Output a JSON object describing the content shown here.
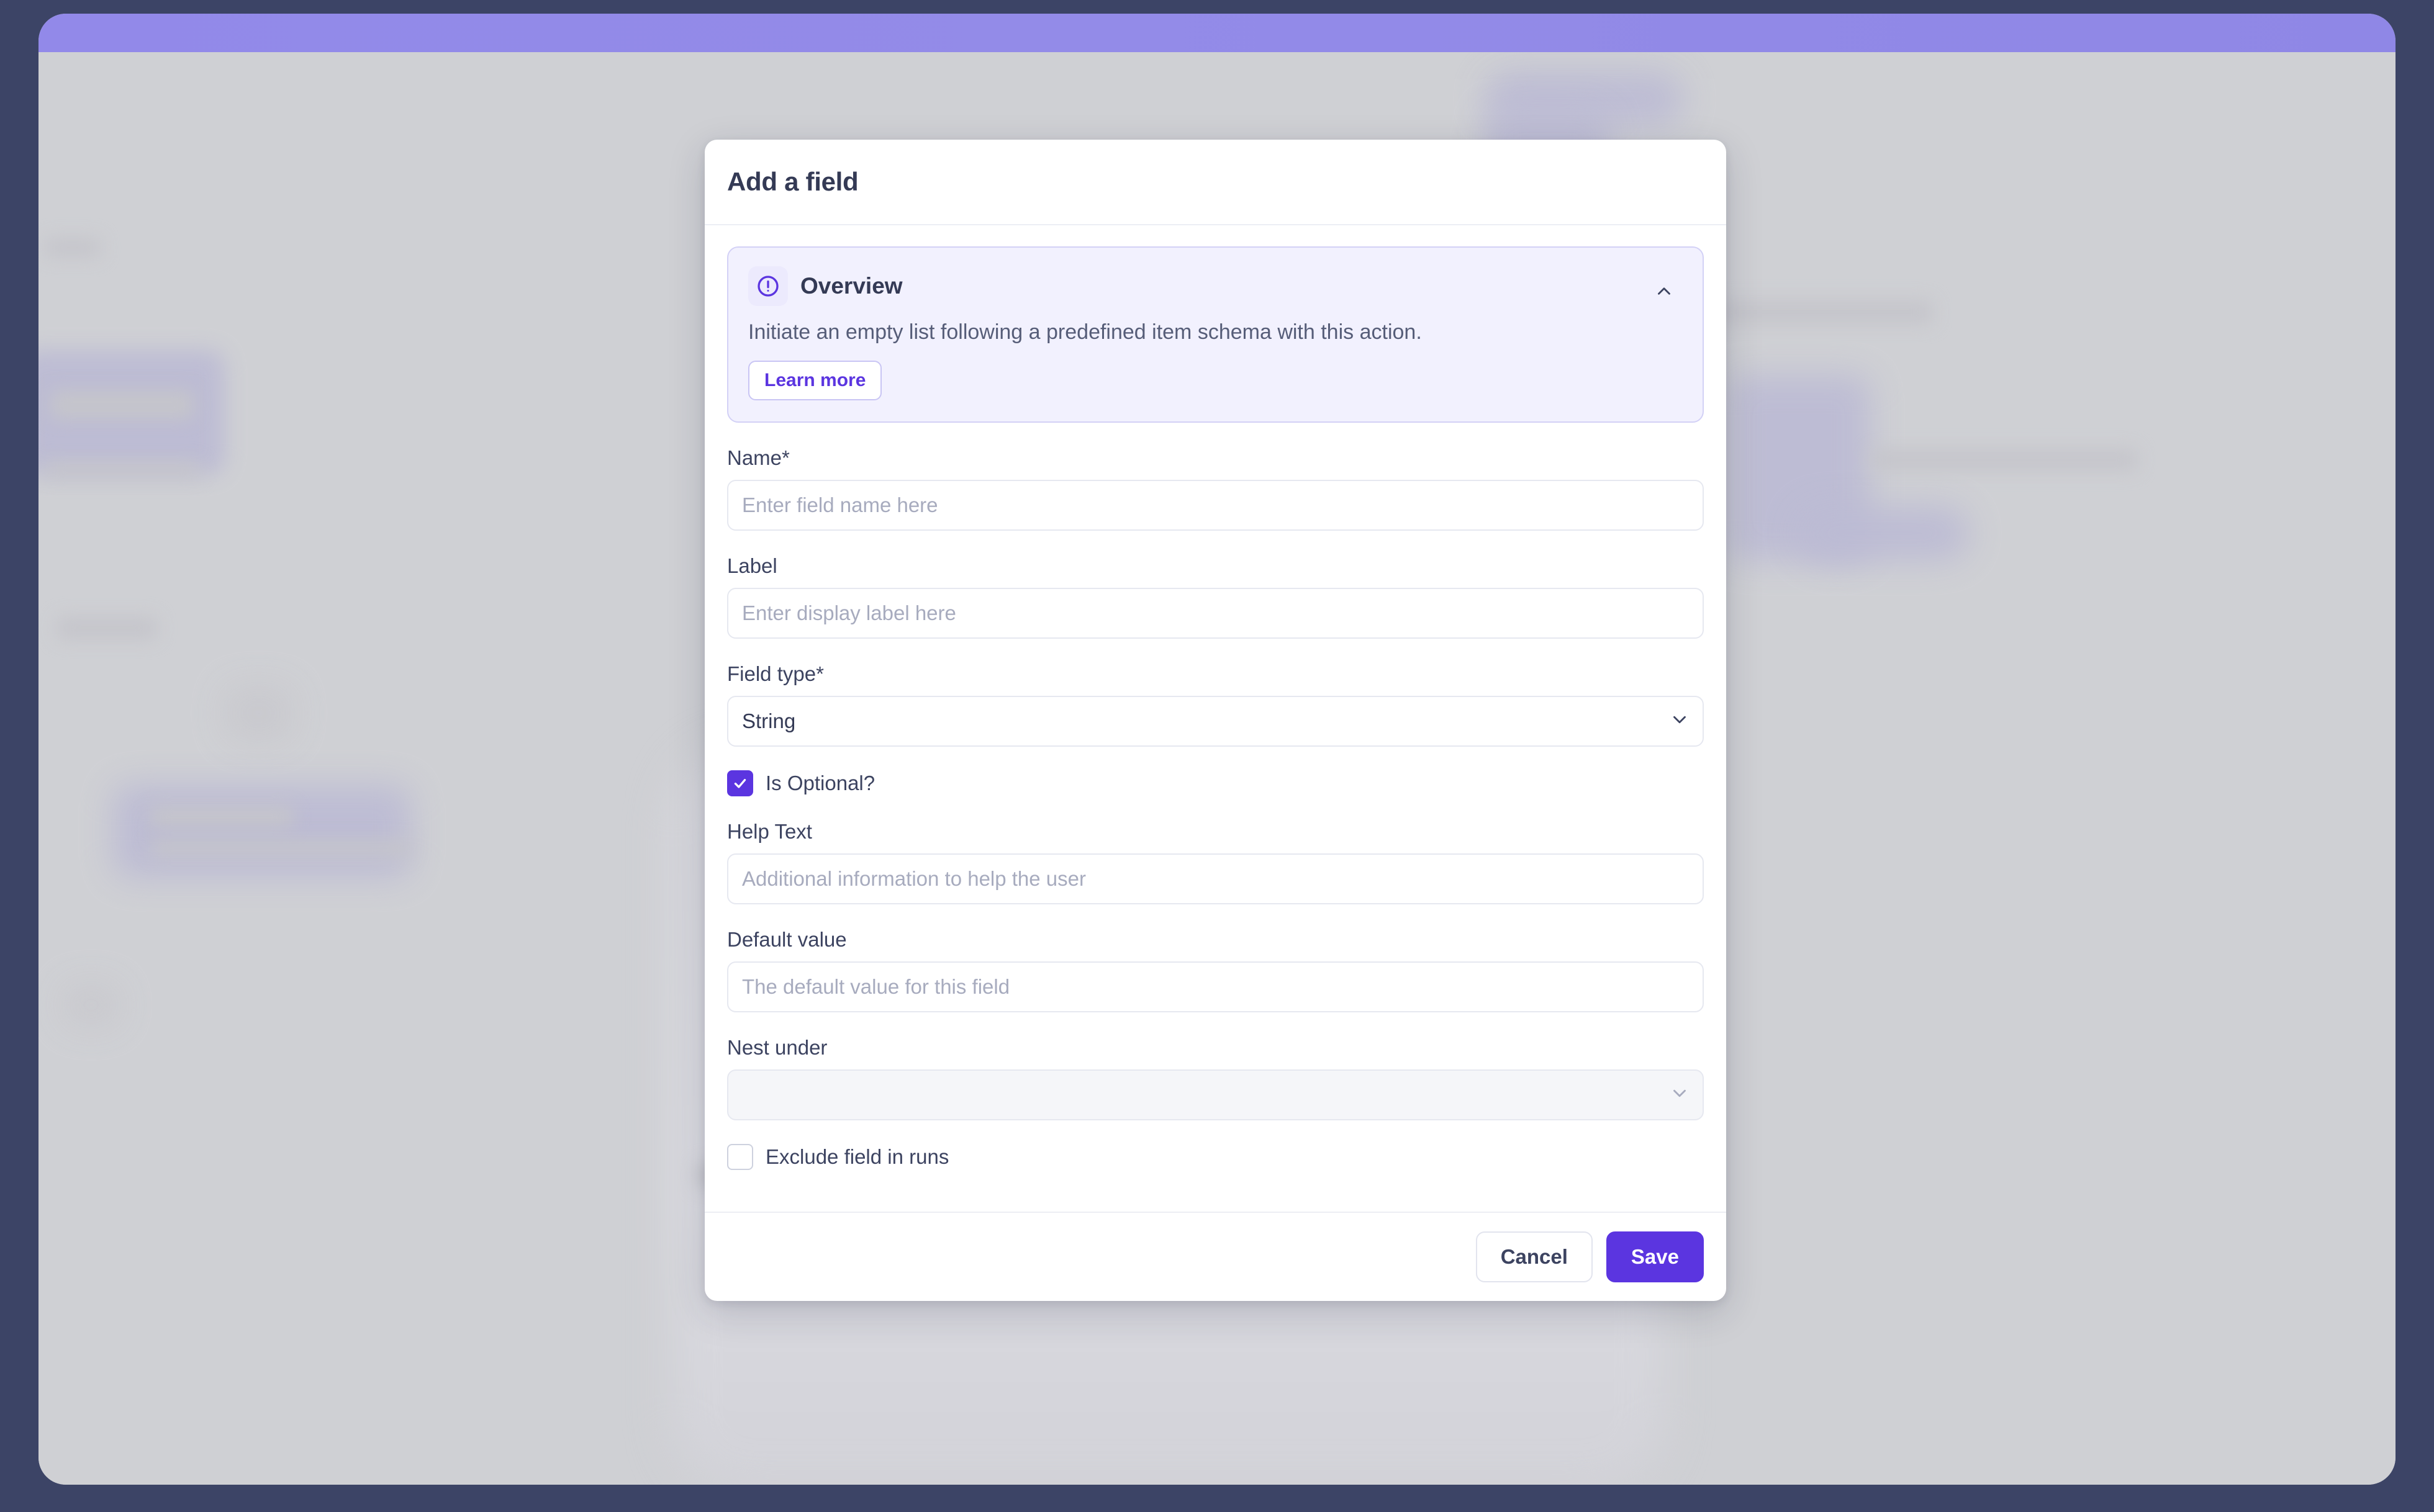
{
  "window": {
    "frame_color": "#3c4466",
    "top_band_color": "#938be8",
    "canvas_color": "#cfd0d4"
  },
  "theme": {
    "accent": "#5b35e0",
    "text_dark": "#343a55",
    "text_muted": "#565d78",
    "placeholder": "#a7abbe",
    "callout_bg": "#f2f1fe",
    "callout_border": "#d3d1f6",
    "input_border": "#e6e8f0",
    "disabled_bg": "#f5f6f9"
  },
  "modal": {
    "title": "Add a field",
    "overview": {
      "icon": "alert-circle-icon",
      "title": "Overview",
      "description": "Initiate an empty list following a predefined item schema with this action.",
      "learn_more_label": "Learn more",
      "collapse_icon": "chevron-up-icon",
      "expanded": true
    },
    "fields": [
      {
        "key": "name",
        "label": "Name*",
        "control": "text",
        "value": "",
        "placeholder": "Enter field name here",
        "required": true
      },
      {
        "key": "label",
        "label": "Label",
        "control": "text",
        "value": "",
        "placeholder": "Enter display label here",
        "required": false
      },
      {
        "key": "field_type",
        "label": "Field type*",
        "control": "select",
        "value": "String",
        "placeholder": "",
        "required": true,
        "chevron_icon": "chevron-down-icon",
        "disabled": false
      }
    ],
    "is_optional": {
      "label": "Is Optional?",
      "checked": true,
      "icon": "check-icon"
    },
    "help_text": {
      "label": "Help Text",
      "value": "",
      "placeholder": "Additional information to help the user"
    },
    "default_value": {
      "label": "Default value",
      "value": "",
      "placeholder": "The default value for this field"
    },
    "nest_under": {
      "label": "Nest under",
      "value": "",
      "placeholder": "",
      "disabled": true,
      "chevron_icon": "chevron-down-icon"
    },
    "exclude_field_in_runs": {
      "label": "Exclude field in runs",
      "checked": false
    },
    "footer": {
      "cancel_label": "Cancel",
      "save_label": "Save"
    }
  }
}
